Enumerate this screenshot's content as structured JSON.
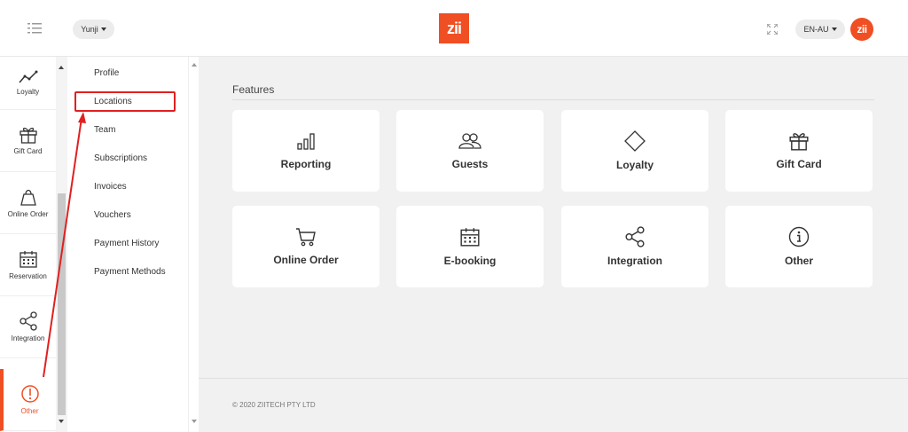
{
  "header": {
    "user_label": "Yunji",
    "logo_text": "zii",
    "language": "EN-AU",
    "avatar_text": "zii"
  },
  "sidebar": {
    "items": [
      {
        "label": "Loyalty",
        "icon": "chart-line-icon"
      },
      {
        "label": "Gift Card",
        "icon": "gift-icon"
      },
      {
        "label": "Online Order",
        "icon": "shopping-bag-icon"
      },
      {
        "label": "Reservation",
        "icon": "calendar-icon"
      },
      {
        "label": "Integration",
        "icon": "share-icon"
      },
      {
        "label": "Other",
        "icon": "alert-circle-icon",
        "active": true
      }
    ]
  },
  "submenu": {
    "items": [
      {
        "label": "Profile"
      },
      {
        "label": "Locations",
        "highlighted": true
      },
      {
        "label": "Team"
      },
      {
        "label": "Subscriptions"
      },
      {
        "label": "Invoices"
      },
      {
        "label": "Vouchers"
      },
      {
        "label": "Payment History"
      },
      {
        "label": "Payment Methods"
      }
    ]
  },
  "main": {
    "section_title": "Features",
    "cards": [
      {
        "label": "Reporting",
        "icon": "bar-chart-icon"
      },
      {
        "label": "Guests",
        "icon": "users-icon"
      },
      {
        "label": "Loyalty",
        "icon": "diamond-icon"
      },
      {
        "label": "Gift Card",
        "icon": "gift-icon"
      },
      {
        "label": "Online Order",
        "icon": "cart-icon"
      },
      {
        "label": "E-booking",
        "icon": "calendar-icon"
      },
      {
        "label": "Integration",
        "icon": "share-icon"
      },
      {
        "label": "Other",
        "icon": "info-icon"
      }
    ],
    "footer": "© 2020 ZIITECH PTY LTD"
  },
  "colors": {
    "brand": "#f04e23",
    "annotation": "#e02020",
    "background": "#f1f1f1"
  }
}
